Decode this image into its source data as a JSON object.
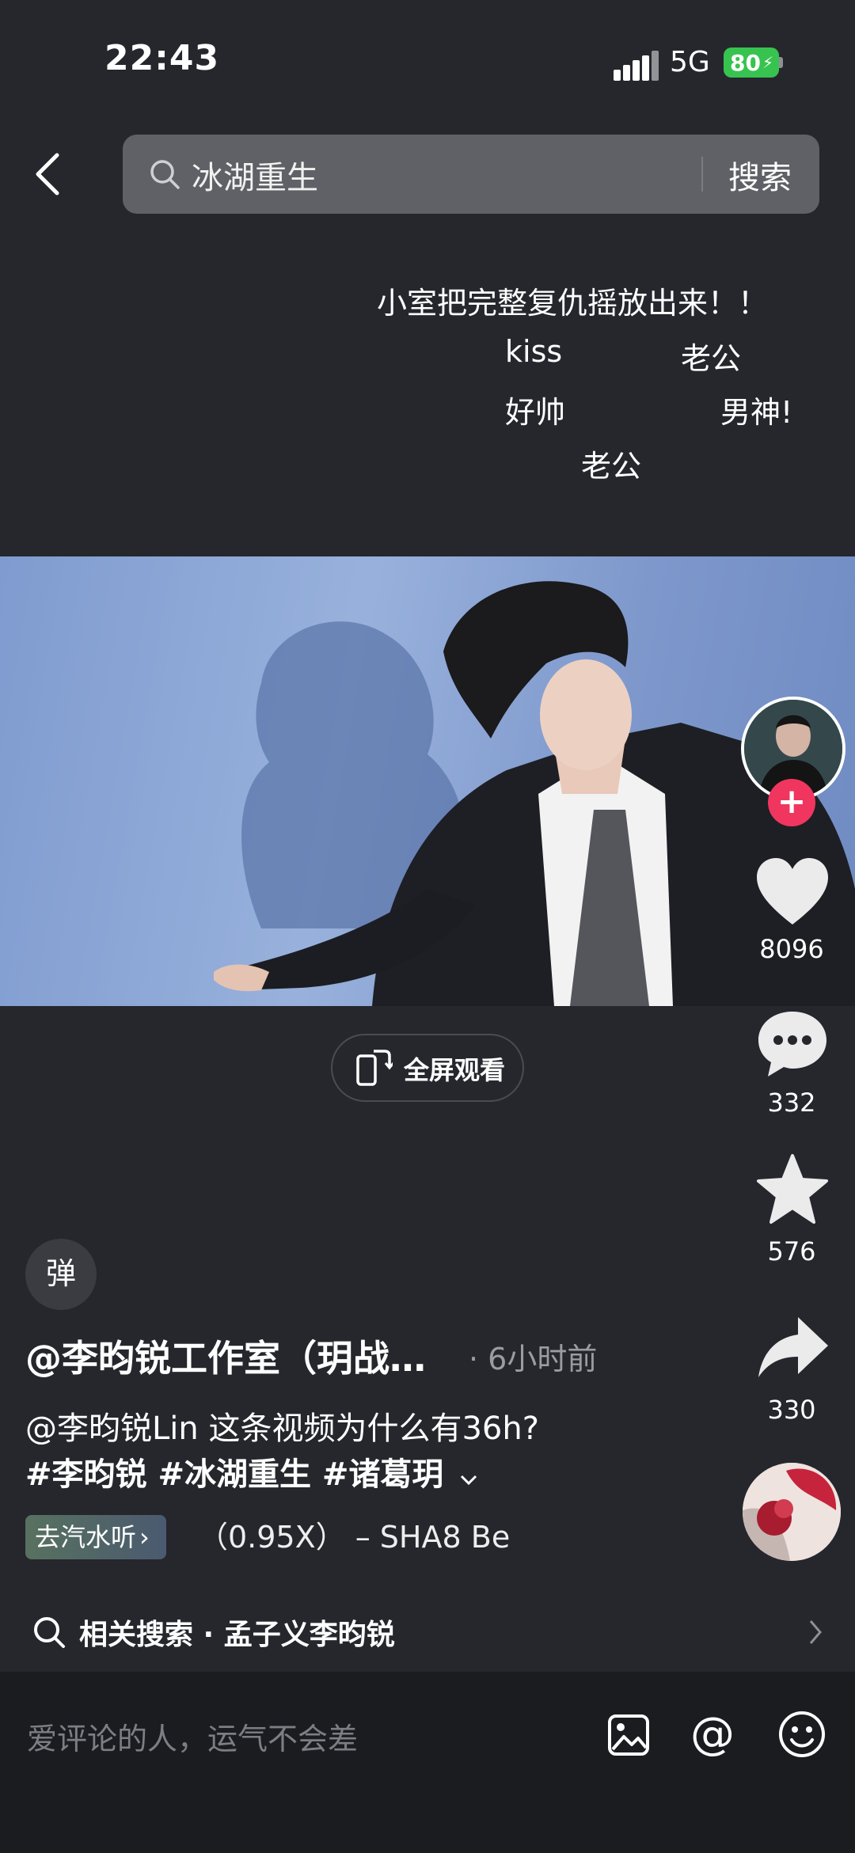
{
  "status": {
    "time": "22:43",
    "network": "5G",
    "battery": "80"
  },
  "search": {
    "query": "冰湖重生",
    "button_label": "搜索"
  },
  "danmaku": [
    "小室把完整复仇摇放出来！！",
    "kiss",
    "老公",
    "好帅",
    "男神!",
    "老公"
  ],
  "fullscreen": {
    "label": "全屏观看"
  },
  "rail": {
    "likes": "8096",
    "comments": "332",
    "favorites": "576",
    "shares": "330",
    "follow_symbol": "+"
  },
  "post": {
    "danmaku_toggle": "弹",
    "author": "@李昀锐工作室（玥战…",
    "time": "· 6小时前",
    "description": "@李昀锐Lin 这条视频为什么有36h?",
    "hashtags": "#李昀锐 #冰湖重生 #诸葛玥",
    "music_tag": "去汽水听",
    "music_text": "（0.95X） – SHA8    Be"
  },
  "related": {
    "text": "相关搜索 · 孟子义李昀锐"
  },
  "comment": {
    "placeholder": "爱评论的人，运气不会差",
    "at_symbol": "@"
  },
  "colors": {
    "background": "#25272d",
    "follow": "#f0365f",
    "battery": "#37c34f"
  }
}
